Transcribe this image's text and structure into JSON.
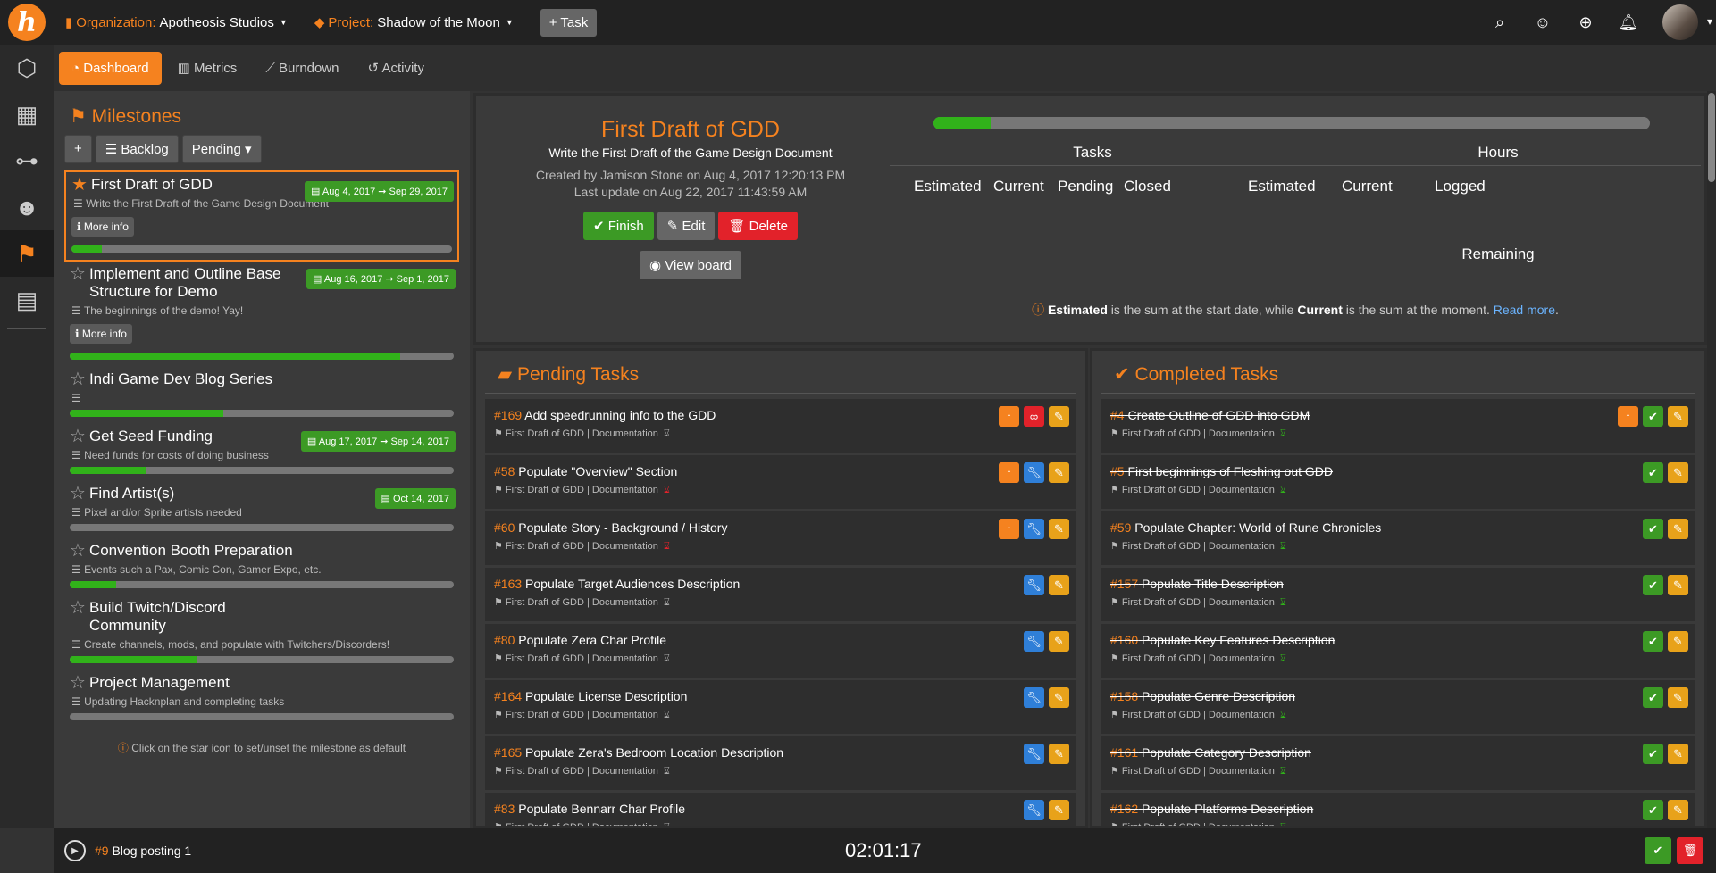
{
  "topbar": {
    "org_label": "Organization:",
    "org_name": "Apotheosis Studios",
    "project_label": "Project:",
    "project_name": "Shadow of the Moon",
    "task_button": "+ Task"
  },
  "subnav": {
    "dashboard": "Dashboard",
    "metrics": "Metrics",
    "burndown": "Burndown",
    "activity": "Activity"
  },
  "milestones": {
    "title": "Milestones",
    "backlog": "Backlog",
    "pending": "Pending",
    "hint": "Click on the star icon to set/unset the milestone as default",
    "more_info": "More info",
    "items": [
      {
        "title": "First Draft of GDD",
        "desc": "Write the First Draft of the Game Design Document",
        "date": "Aug 4, 2017 ➞ Sep 29, 2017",
        "progress": 8
      },
      {
        "title": "Implement and Outline Base Structure for Demo",
        "desc": "The beginnings of the demo! Yay!",
        "date": "Aug 16, 2017 ➞ Sep 1, 2017",
        "progress": 86
      },
      {
        "title": "Indi Game Dev Blog Series",
        "desc": "",
        "date": "",
        "progress": 40
      },
      {
        "title": "Get Seed Funding",
        "desc": "Need funds for costs of doing business",
        "date": "Aug 17, 2017 ➞ Sep 14, 2017",
        "progress": 20
      },
      {
        "title": "Find Artist(s)",
        "desc": "Pixel and/or Sprite artists needed",
        "date": "Oct 14, 2017",
        "progress": 0
      },
      {
        "title": "Convention Booth Preparation",
        "desc": "Events such a Pax, Comic Con, Gamer Expo, etc.",
        "date": "",
        "progress": 12
      },
      {
        "title": "Build Twitch/Discord Community",
        "desc": "Create channels, mods, and populate with Twitchers/Discorders!",
        "date": "",
        "progress": 33
      },
      {
        "title": "Project Management",
        "desc": "Updating Hacknplan and completing tasks",
        "date": "",
        "progress": 0
      }
    ]
  },
  "detail": {
    "title": "First Draft of GDD",
    "subtitle": "Write the First Draft of the Game Design Document",
    "created": "Created by Jamison Stone on Aug 4, 2017 12:20:13 PM",
    "updated": "Last update on Aug 22, 2017 11:43:59 AM",
    "finish": "Finish",
    "edit": "Edit",
    "delete": "Delete",
    "view_board": "View board",
    "progress": 8,
    "tasks_label": "Tasks",
    "hours_label": "Hours",
    "estimated": "Estimated",
    "current": "Current",
    "pending": "Pending",
    "closed": "Closed",
    "h_estimated": "Estimated",
    "h_current": "Current",
    "logged": "Logged",
    "remaining": "Remaining",
    "note_b1": "Estimated",
    "note_t1": " is the sum at the start date, while ",
    "note_b2": "Current",
    "note_t2": " is the sum at the moment. ",
    "read_more": "Read more",
    "note_end": "."
  },
  "pending": {
    "title": "Pending Tasks",
    "meta": "First Draft of GDD | Documentation",
    "tasks": [
      {
        "num": "#169",
        "title": "Add speedrunning info to the GDD"
      },
      {
        "num": "#58",
        "title": "Populate \"Overview\" Section"
      },
      {
        "num": "#60",
        "title": "Populate Story - Background / History"
      },
      {
        "num": "#163",
        "title": "Populate Target Audiences Description"
      },
      {
        "num": "#80",
        "title": "Populate Zera Char Profile"
      },
      {
        "num": "#164",
        "title": "Populate License Description"
      },
      {
        "num": "#165",
        "title": "Populate Zera's Bedroom Location Description"
      },
      {
        "num": "#83",
        "title": "Populate Bennarr Char Profile"
      }
    ]
  },
  "completed": {
    "title": "Completed Tasks",
    "meta": "First Draft of GDD | Documentation",
    "tasks": [
      {
        "num": "#4",
        "title": "Create Outline of GDD into GDM"
      },
      {
        "num": "#5",
        "title": "First beginnings of Fleshing out GDD"
      },
      {
        "num": "#59",
        "title": "Populate Chapter: World of Rune Chronicles"
      },
      {
        "num": "#157",
        "title": "Populate Title Description"
      },
      {
        "num": "#160",
        "title": "Populate Key Features Description"
      },
      {
        "num": "#158",
        "title": "Populate Genre Description"
      },
      {
        "num": "#161",
        "title": "Populate Category Description"
      },
      {
        "num": "#162",
        "title": "Populate Platforms Description"
      }
    ]
  },
  "footer": {
    "task_num": "#9",
    "task_title": "Blog posting 1",
    "timer": "02:01:17"
  }
}
